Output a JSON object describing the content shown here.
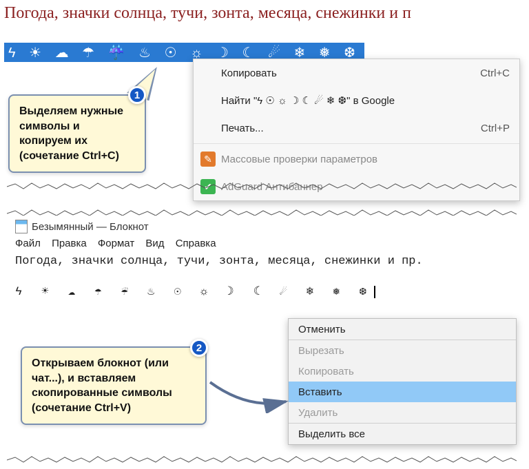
{
  "heading": "Погода, значки солнца, тучи, зонта, месяца, снежинки и п",
  "selected_symbols": "ϟ ☀ ☁ ☂ ☔ ♨ ☉ ☼ ☽ ☾ ☄ ❄ ❅ ❆",
  "callout1": {
    "text": "Выделяем нужные символы и копируем их (сочетание Ctrl+C)",
    "num": "1"
  },
  "ctx1": {
    "copy": {
      "label": "Копировать",
      "short": "Ctrl+C"
    },
    "search": {
      "prefix": "Найти \"",
      "body": "ϟ   ☉ ☼ ☽ ☾ ☄   ❄ ❆",
      "suffix": "\" в Google"
    },
    "print": {
      "label": "Печать...",
      "short": "Ctrl+P"
    },
    "mass": {
      "label": "Массовые проверки параметров"
    },
    "adguard": {
      "label": "AdGuard Антибаннер"
    }
  },
  "notepad": {
    "title": "Безымянный — Блокнот",
    "menu": {
      "file": "Файл",
      "edit": "Правка",
      "format": "Формат",
      "view": "Вид",
      "help": "Справка"
    },
    "line1": "Погода, значки солнца, тучи, зонта, месяца, снежинки и пр.",
    "symbols": "ϟ ☀ ☁ ☂ ☔ ♨ ☉ ☼ ☽ ☾ ☄ ❄ ❅ ❆"
  },
  "callout2": {
    "text": "Открываем блокнот (или чат...), и вставляем скопированные символы (сочетание Ctrl+V)",
    "num": "2"
  },
  "ctx2": {
    "undo": "Отменить",
    "cut": "Вырезать",
    "copy": "Копировать",
    "paste": "Вставить",
    "delete": "Удалить",
    "selectall": "Выделить все"
  }
}
